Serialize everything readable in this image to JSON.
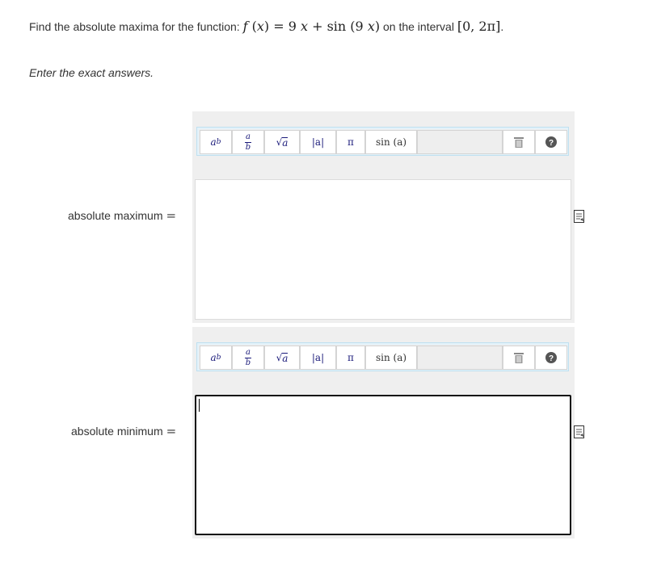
{
  "question": {
    "prefix": "Find the absolute maxima for the function:",
    "function_tex": "f(x) = 9x + sin(9x)",
    "middle": "on the interval",
    "interval": "[0, 2π]",
    "suffix": "."
  },
  "instruction": "Enter the exact answers.",
  "toolbar": {
    "power": {
      "base": "a",
      "exp": "b"
    },
    "fraction": {
      "num": "a",
      "den": "b"
    },
    "sqrt": {
      "radicand": "a"
    },
    "abs": "|a|",
    "pi": "π",
    "sin": "sin (a)"
  },
  "answers": [
    {
      "label": "absolute maximum",
      "eq": "=",
      "value": ""
    },
    {
      "label": "absolute minimum",
      "eq": "=",
      "value": ""
    }
  ]
}
